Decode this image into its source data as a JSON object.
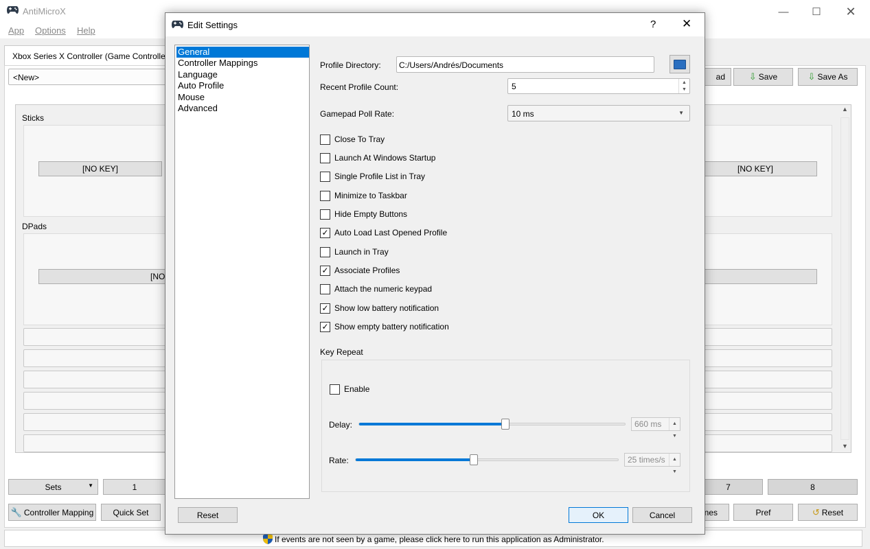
{
  "app": {
    "title": "AntiMicroX",
    "menu": [
      "App",
      "Options",
      "Help"
    ],
    "controller_tab": "Xbox Series X Controller (Game Controller",
    "profile_combo": "<New>",
    "load_partial": "ad",
    "save": "Save",
    "save_as": "Save As",
    "sticks_label": "Sticks",
    "dpads_label": "DPads",
    "no_key": "[NO KEY]",
    "no_key_partial": "[NO",
    "sets": "Sets",
    "set_1": "1",
    "set_7": "7",
    "set_8": "8",
    "controller_mapping": "Controller Mapping",
    "quick_set": "Quick Set",
    "names_partial": "nes",
    "pref": "Pref",
    "reset": "Reset",
    "status": "If events are not seen by a game, please click here to run this application as Administrator."
  },
  "dialog": {
    "title": "Edit Settings",
    "help": "?",
    "categories": [
      "General",
      "Controller Mappings",
      "Language",
      "Auto Profile",
      "Mouse",
      "Advanced"
    ],
    "selected_category": "General",
    "profile_dir_label": "Profile Directory:",
    "profile_dir_value": "C:/Users/Andrés/Documents",
    "recent_count_label": "Recent Profile Count:",
    "recent_count_value": "5",
    "poll_rate_label": "Gamepad Poll Rate:",
    "poll_rate_value": "10 ms",
    "checkboxes": [
      {
        "label": "Close To Tray",
        "checked": false
      },
      {
        "label": "Launch At Windows Startup",
        "checked": false
      },
      {
        "label": "Single Profile List in Tray",
        "checked": false
      },
      {
        "label": "Minimize to Taskbar",
        "checked": false
      },
      {
        "label": "Hide Empty Buttons",
        "checked": false
      },
      {
        "label": "Auto Load Last Opened Profile",
        "checked": true
      },
      {
        "label": "Launch in Tray",
        "checked": false
      },
      {
        "label": "Associate Profiles",
        "checked": true
      },
      {
        "label": "Attach the numeric keypad",
        "checked": false
      },
      {
        "label": "Show low battery notification",
        "checked": true
      },
      {
        "label": "Show empty battery notification",
        "checked": true
      }
    ],
    "key_repeat_label": "Key Repeat",
    "enable_label": "Enable",
    "enable_checked": false,
    "delay_label": "Delay:",
    "delay_value": "660 ms",
    "delay_fraction": 0.55,
    "rate_label": "Rate:",
    "rate_value": "25 times/s",
    "rate_fraction": 0.45,
    "reset": "Reset",
    "ok": "OK",
    "cancel": "Cancel"
  },
  "colors": {
    "accent": "#0078d7",
    "shield": "#f4c20d"
  }
}
